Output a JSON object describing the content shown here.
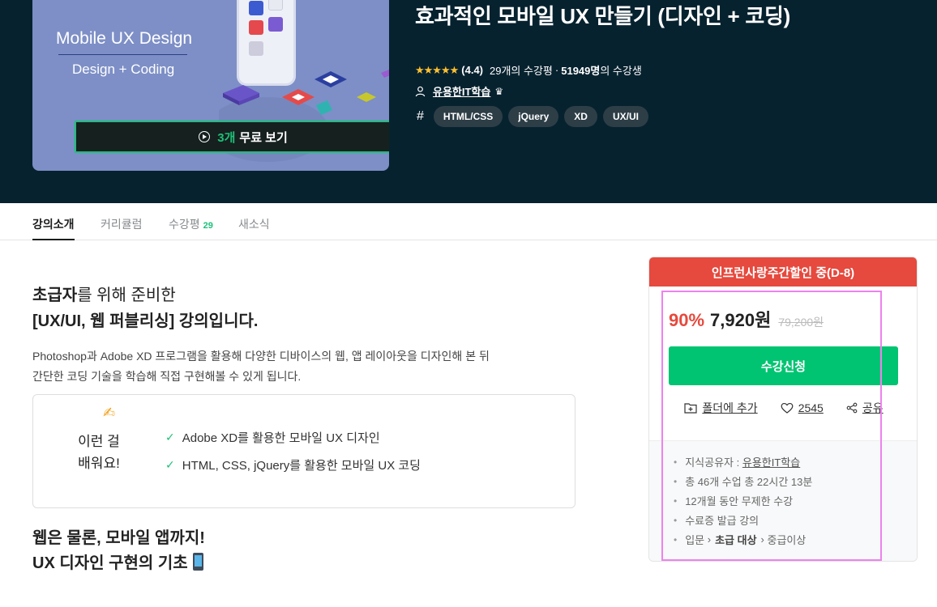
{
  "thumbnail": {
    "title": "Mobile UX Design",
    "subtitle": "Design + Coding",
    "preview_count": "3개",
    "preview_label": "무료 보기"
  },
  "course": {
    "title": "효과적인 모바일 UX 만들기 (디자인 + 코딩)",
    "stars": "★★★★★",
    "rating": "(4.4)",
    "reviews": "29개의 수강평",
    "students_num": "51949명",
    "students_suffix": "의 수강생",
    "instructor": "유용한IT학습",
    "tags_symbol": "#",
    "tags": [
      "HTML/CSS",
      "jQuery",
      "XD",
      "UX/UI"
    ]
  },
  "tabs": [
    {
      "label": "강의소개"
    },
    {
      "label": "커리큘럼"
    },
    {
      "label": "수강평",
      "badge": "29"
    },
    {
      "label": "새소식"
    }
  ],
  "intro": {
    "line1_bold": "초급자",
    "line1_rest": "를 위해 준비한",
    "line2": "[UX/UI, 웹 퍼블리싱] 강의입니다.",
    "desc1": "Photoshop과 Adobe XD 프로그램을 활용해 다양한 디바이스의 웹, 앱 레이아웃을 디자인해 본 뒤",
    "desc2": "간단한 코딩 기술을 학습해 직접 구현해볼 수 있게 됩니다."
  },
  "learn": {
    "label_line1": "이런 걸",
    "label_line2": "배워요!",
    "items": [
      "Adobe XD를 활용한 모바일 UX 디자인",
      "HTML, CSS, jQuery를 활용한 모바일 UX 코딩"
    ]
  },
  "section2": {
    "line1": "웹은 물론, 모바일 앱까지!",
    "line2": "UX 디자인 구현의 기초"
  },
  "card": {
    "banner": "인프런사랑주간할인 중(D-8)",
    "discount": "90%",
    "price": "7,920원",
    "original_price": "79,200원",
    "enroll": "수강신청",
    "folder": "폴더에 추가",
    "likes": "2545",
    "share": "공유",
    "info": {
      "sharer_label": "지식공유자 :",
      "sharer": "유용한IT학습",
      "lessons": "총 46개 수업 총 22시간 13분",
      "period": "12개월 동안 무제한 수강",
      "certificate": "수료증 발급 강의",
      "level_start": "입문",
      "level_target": "초급 대상",
      "level_end": "중급이상"
    }
  },
  "colors": {
    "hero_bg": "#07222f",
    "accent_green": "#00c471",
    "sale_red": "#e6493d",
    "highlight": "#ee82ee"
  }
}
